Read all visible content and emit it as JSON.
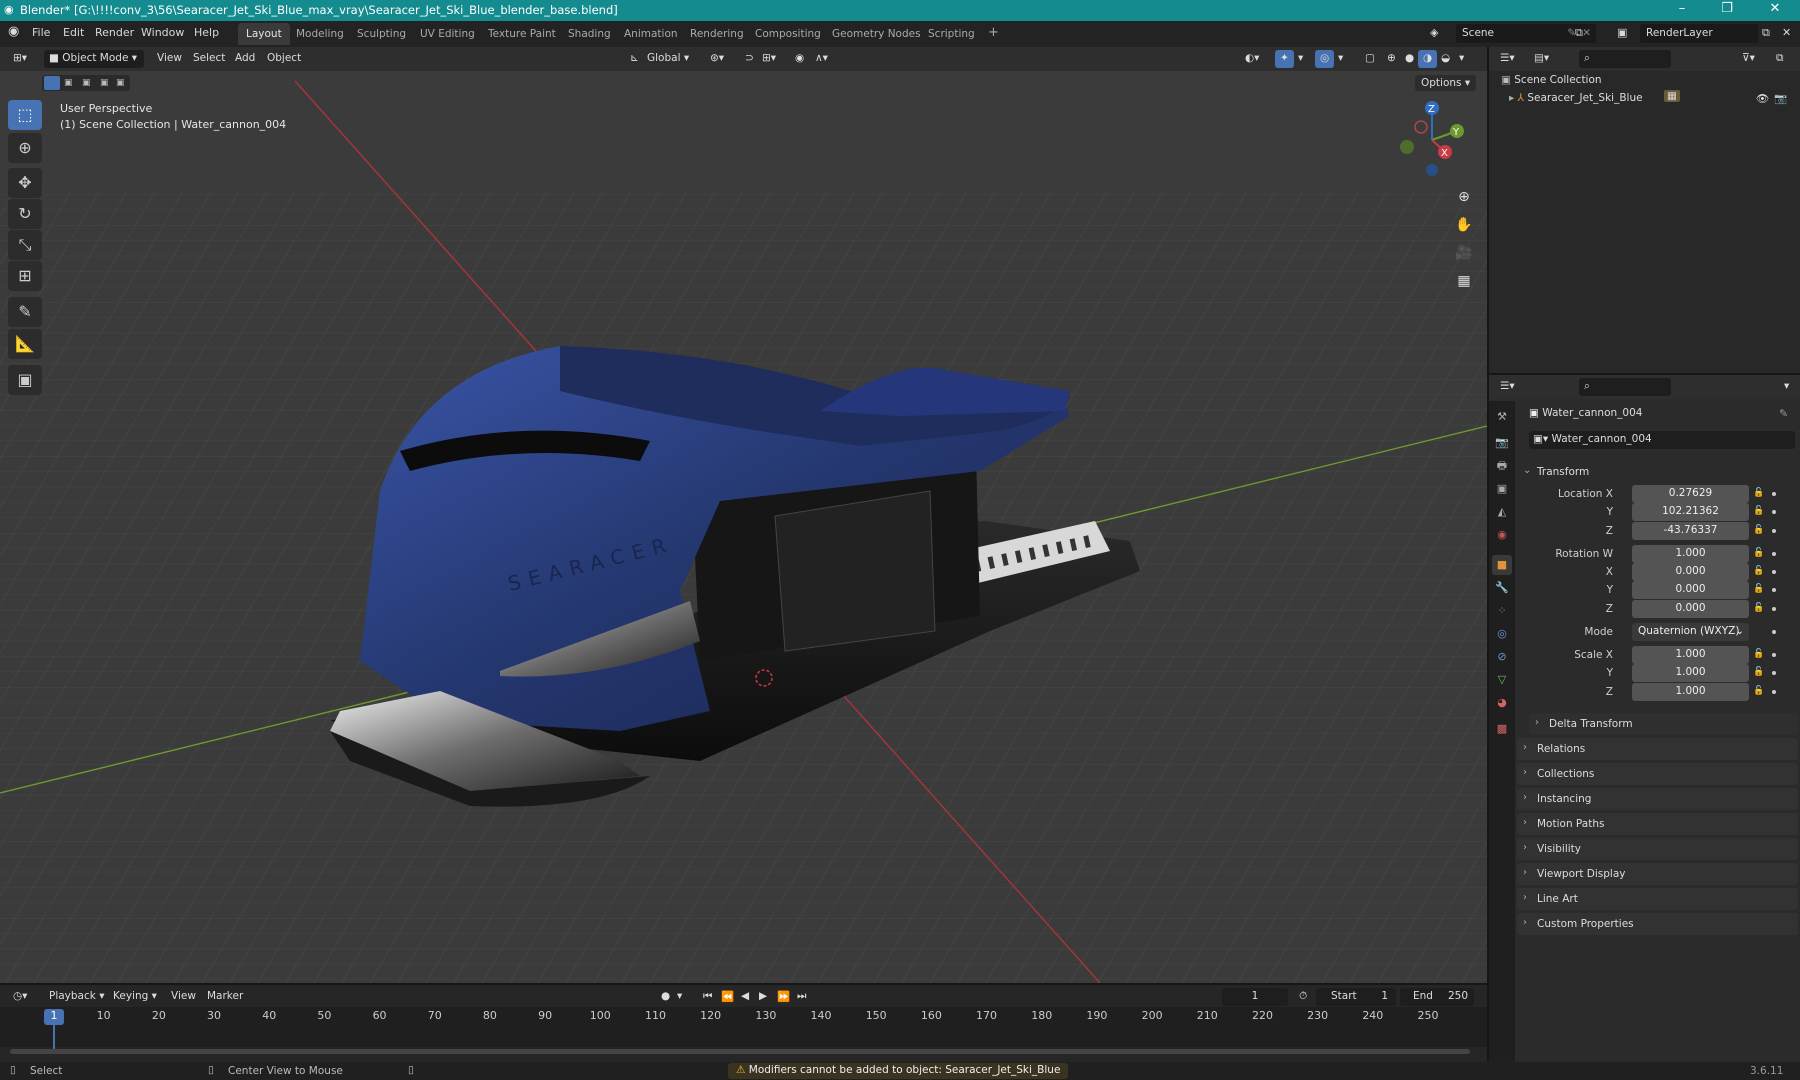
{
  "titlebar": {
    "title": "Blender* [G:\\!!!!conv_3\\56\\Searacer_Jet_Ski_Blue_max_vray\\Searacer_Jet_Ski_Blue_blender_base.blend]",
    "minimize": "–",
    "maximize": "❐",
    "close": "✕"
  },
  "menu": {
    "file": "File",
    "edit": "Edit",
    "render": "Render",
    "window": "Window",
    "help": "Help"
  },
  "workspaces": [
    "Layout",
    "Modeling",
    "Sculpting",
    "UV Editing",
    "Texture Paint",
    "Shading",
    "Animation",
    "Rendering",
    "Compositing",
    "Geometry Nodes",
    "Scripting"
  ],
  "scene": {
    "name": "Scene",
    "render_layer": "RenderLayer"
  },
  "viewport_header": {
    "mode": "Object Mode",
    "view": "View",
    "select": "Select",
    "add": "Add",
    "object": "Object",
    "orientation": "Global",
    "options": "Options"
  },
  "viewport": {
    "line1": "User Perspective",
    "line2": "(1) Scene Collection | Water_cannon_004",
    "brand_text": "SEARACER"
  },
  "gizmo": {
    "z": "Z",
    "y": "Y",
    "x": "X"
  },
  "outliner": {
    "root": "Scene Collection",
    "item": "Searacer_Jet_Ski_Blue"
  },
  "properties": {
    "object_name": "Water_cannon_004",
    "datablock": "Water_cannon_004",
    "transform_label": "Transform",
    "location_label": "Location X",
    "location": [
      "0.27629",
      "102.21362",
      "-43.76337"
    ],
    "rotation_label": "Rotation W",
    "rotation": [
      "1.000",
      "0.000",
      "0.000",
      "0.000"
    ],
    "mode_label": "Mode",
    "mode_value": "Quaternion (WXYZ)",
    "scale_label": "Scale X",
    "scale": [
      "1.000",
      "1.000",
      "1.000"
    ],
    "axis_y": "Y",
    "axis_z": "Z",
    "axis_x": "X",
    "delta": "Delta Transform",
    "panels": [
      "Relations",
      "Collections",
      "Instancing",
      "Motion Paths",
      "Visibility",
      "Viewport Display",
      "Line Art",
      "Custom Properties"
    ]
  },
  "timeline": {
    "playback": "Playback",
    "keying": "Keying",
    "view": "View",
    "marker": "Marker",
    "current_frame": "1",
    "start_label": "Start",
    "start": "1",
    "end_label": "End",
    "end": "250",
    "ticks": [
      "1",
      "10",
      "20",
      "30",
      "40",
      "50",
      "60",
      "70",
      "80",
      "90",
      "100",
      "110",
      "120",
      "130",
      "140",
      "150",
      "160",
      "170",
      "180",
      "190",
      "200",
      "210",
      "220",
      "230",
      "240",
      "250"
    ]
  },
  "status": {
    "select": "Select",
    "center": "Center View to Mouse",
    "warning": "Modifiers cannot be added to object: Searacer_Jet_Ski_Blue",
    "version": "3.6.11"
  },
  "colors": {
    "accent": "#4772b3",
    "titlebar": "#148b8f",
    "x_axis": "#a8353a",
    "y_axis": "#6c9a2f",
    "z_axis": "#2f6ec2",
    "jetski_blue": "#2b3f85"
  }
}
